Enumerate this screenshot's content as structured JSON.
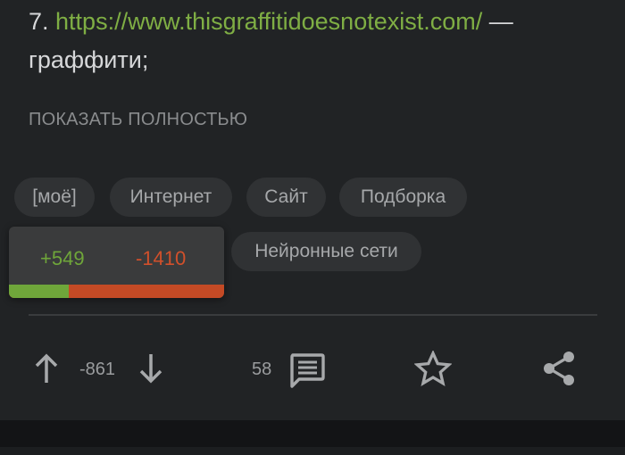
{
  "post": {
    "item_prefix": "7. ",
    "link": "https://www.thisgraffitidoesnotexist.com/",
    "dash": " —",
    "description": "граффити;",
    "show_more": "ПОКАЗАТЬ ПОЛНОСТЬЮ"
  },
  "tags": [
    {
      "label": "[моё]"
    },
    {
      "label": "Интернет"
    },
    {
      "label": "Сайт"
    },
    {
      "label": "Подборка"
    },
    {
      "label": "Нейронные сети"
    }
  ],
  "rating_popup": {
    "plus": "+549",
    "minus": "-1410",
    "positive_fraction": 0.28,
    "colors": {
      "positive": "#6fa63a",
      "negative": "#c44a25"
    }
  },
  "actions": {
    "rating": "-861",
    "comments_count": "58",
    "icons": [
      "arrow-up-icon",
      "arrow-down-icon",
      "comment-icon",
      "star-icon",
      "share-icon"
    ]
  },
  "colors": {
    "link": "#7fae44",
    "background": "#212325",
    "tag_background": "#303234"
  }
}
